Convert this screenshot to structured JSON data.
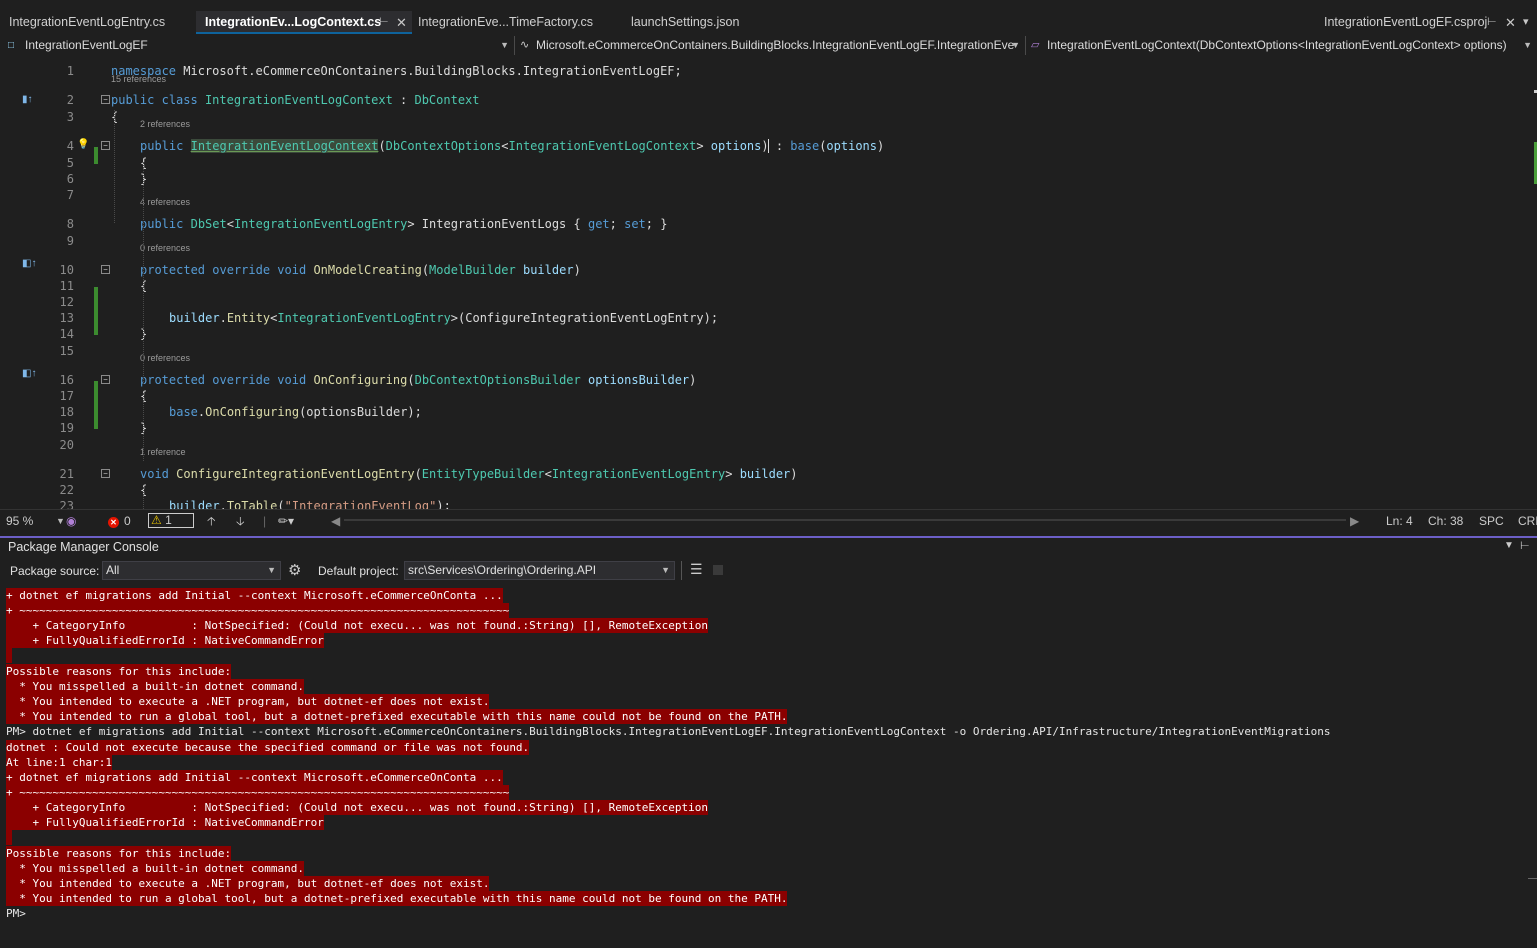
{
  "tabs": [
    {
      "label": "IntegrationEventLogEntry.cs",
      "active": false
    },
    {
      "label": "IntegrationEv...LogContext.cs",
      "active": true
    },
    {
      "label": "IntegrationEve...TimeFactory.cs",
      "active": false
    },
    {
      "label": "launchSettings.json",
      "active": false
    },
    {
      "label": "IntegrationEventLogEF.csproj",
      "active": false
    }
  ],
  "nav": {
    "project": "IntegrationEventLogEF",
    "type": "Microsoft.eCommerceOnContainers.BuildingBlocks.IntegrationEventLogEF.IntegrationEve",
    "member": "IntegrationEventLogContext(DbContextOptions<IntegrationEventLogContext> options)"
  },
  "editor": {
    "line_numbers": [
      "1",
      "2",
      "3",
      "4",
      "5",
      "6",
      "7",
      "8",
      "9",
      "10",
      "11",
      "12",
      "13",
      "14",
      "15",
      "16",
      "17",
      "18",
      "19",
      "20",
      "21",
      "22",
      "23"
    ],
    "code_lens": [
      "15 references",
      "2 references",
      "4 references",
      "0 references",
      "0 references",
      "1 reference"
    ],
    "code": {
      "l1": [
        "namespace",
        " Microsoft.eCommerceOnContainers.BuildingBlocks.IntegrationEventLogEF;"
      ],
      "l2": [
        "public",
        " ",
        "class",
        " ",
        "IntegrationEventLogContext",
        " : ",
        "DbContext"
      ],
      "l3": "{",
      "l4": [
        "public",
        " ",
        "IntegrationEventLogContext",
        "(",
        "DbContextOptions",
        "<",
        "IntegrationEventLogContext",
        "> ",
        "options",
        ") : ",
        "base",
        "(",
        "options",
        ")"
      ],
      "l5": "{",
      "l6": "}",
      "l8": [
        "public",
        " ",
        "DbSet",
        "<",
        "IntegrationEventLogEntry",
        "> IntegrationEventLogs { ",
        "get",
        "; ",
        "set",
        "; }"
      ],
      "l10": [
        "protected",
        " ",
        "override",
        " ",
        "void",
        " ",
        "OnModelCreating",
        "(",
        "ModelBuilder",
        " ",
        "builder",
        ")"
      ],
      "l11": "{",
      "l13": [
        "builder",
        ".",
        "Entity",
        "<",
        "IntegrationEventLogEntry",
        ">(ConfigureIntegrationEventLogEntry);"
      ],
      "l14": "}",
      "l16": [
        "protected",
        " ",
        "override",
        " ",
        "void",
        " ",
        "OnConfiguring",
        "(",
        "DbContextOptionsBuilder",
        " ",
        "optionsBuilder",
        ")"
      ],
      "l17": "{",
      "l18": [
        "base",
        ".",
        "OnConfiguring",
        "(optionsBuilder);"
      ],
      "l19": "}",
      "l21": [
        "void",
        " ",
        "ConfigureIntegrationEventLogEntry",
        "(",
        "EntityTypeBuilder",
        "<",
        "IntegrationEventLogEntry",
        "> ",
        "builder",
        ")"
      ],
      "l22": "{",
      "l23": [
        "builder",
        ".",
        "ToTable",
        "(",
        "\"IntegrationEventLog\"",
        ");"
      ]
    }
  },
  "status": {
    "zoom": "95 %",
    "errors": "0",
    "warnings": "1",
    "line": "Ln: 4",
    "char": "Ch: 38",
    "spc": "SPC",
    "crlf": "CRL"
  },
  "pmc": {
    "title": "Package Manager Console",
    "source_label": "Package source:",
    "source_value": "All",
    "project_label": "Default project:",
    "project_value": "src\\Services\\Ordering\\Ordering.API"
  },
  "console_lines": [
    {
      "text": "+ dotnet ef migrations add Initial --context Microsoft.eCommerceOnConta ...",
      "kind": "err"
    },
    {
      "text": "+ ~~~~~~~~~~~~~~~~~~~~~~~~~~~~~~~~~~~~~~~~~~~~~~~~~~~~~~~~~~~~~~~~~~~~~~~~~~",
      "kind": "err"
    },
    {
      "text": "    + CategoryInfo          : NotSpecified: (Could not execu... was not found.:String) [], RemoteException",
      "kind": "err"
    },
    {
      "text": "    + FullyQualifiedErrorId : NativeCommandError",
      "kind": "err"
    },
    {
      "text": "",
      "kind": "gap"
    },
    {
      "text": "Possible reasons for this include:",
      "kind": "err"
    },
    {
      "text": "  * You misspelled a built-in dotnet command.",
      "kind": "err"
    },
    {
      "text": "  * You intended to execute a .NET program, but dotnet-ef does not exist.",
      "kind": "err"
    },
    {
      "text": "  * You intended to run a global tool, but a dotnet-prefixed executable with this name could not be found on the PATH.",
      "kind": "err"
    },
    {
      "text": "PM> dotnet ef migrations add Initial --context Microsoft.eCommerceOnContainers.BuildingBlocks.IntegrationEventLogEF.IntegrationEventLogContext -o Ordering.API/Infrastructure/IntegrationEventMigrations",
      "kind": "norm"
    },
    {
      "text": "dotnet : Could not execute because the specified command or file was not found.",
      "kind": "err"
    },
    {
      "text": "At line:1 char:1",
      "kind": "err"
    },
    {
      "text": "+ dotnet ef migrations add Initial --context Microsoft.eCommerceOnConta ...",
      "kind": "err"
    },
    {
      "text": "+ ~~~~~~~~~~~~~~~~~~~~~~~~~~~~~~~~~~~~~~~~~~~~~~~~~~~~~~~~~~~~~~~~~~~~~~~~~~",
      "kind": "err"
    },
    {
      "text": "    + CategoryInfo          : NotSpecified: (Could not execu... was not found.:String) [], RemoteException",
      "kind": "err"
    },
    {
      "text": "    + FullyQualifiedErrorId : NativeCommandError",
      "kind": "err"
    },
    {
      "text": "",
      "kind": "gap"
    },
    {
      "text": "Possible reasons for this include:",
      "kind": "err"
    },
    {
      "text": "  * You misspelled a built-in dotnet command.",
      "kind": "err"
    },
    {
      "text": "  * You intended to execute a .NET program, but dotnet-ef does not exist.",
      "kind": "err"
    },
    {
      "text": "  * You intended to run a global tool, but a dotnet-prefixed executable with this name could not be found on the PATH.",
      "kind": "err"
    },
    {
      "text": "PM>",
      "kind": "norm"
    }
  ],
  "colors": {
    "keyword": "#569cd6",
    "type": "#4ec9b0",
    "method": "#dcdcaa",
    "parameter": "#9cdcfe",
    "string": "#d69d85",
    "error_background": "#8b0000",
    "change_bar": "#3c8b2f",
    "accent": "#6c5fc7"
  },
  "icons": [
    "pin-icon",
    "close-icon",
    "error-icon",
    "warning-icon",
    "arrow-up-icon",
    "arrow-down-icon",
    "brush-icon",
    "settings-icon",
    "clear-console-icon",
    "stop-icon",
    "lightbulb-icon"
  ]
}
